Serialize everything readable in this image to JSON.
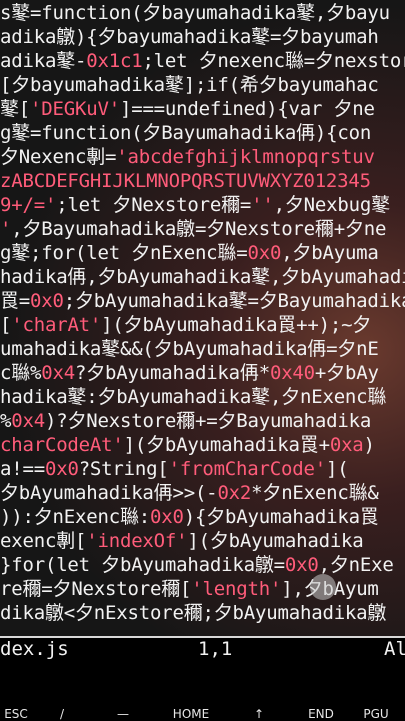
{
  "editor": {
    "lines": [
      [
        {
          "t": "pln",
          "v": "s鼕=function(夕bayumahadika鼕,夕bayu"
        }
      ],
      [
        {
          "t": "pln",
          "v": "adika鷻){夕bayumahadika鼕=夕bayumah"
        }
      ],
      [
        {
          "t": "pln",
          "v": "adika鼕-"
        },
        {
          "t": "num",
          "v": "0x1c1"
        },
        {
          "t": "pln",
          "v": ";let 夕nexenc䏈=夕nexstor"
        }
      ],
      [
        {
          "t": "pln",
          "v": "[夕bayumahadika鼕];if(希夕bayumahac"
        }
      ],
      [
        {
          "t": "pln",
          "v": "鼕["
        },
        {
          "t": "str",
          "v": "'DEGKuV'"
        },
        {
          "t": "pln",
          "v": "]===undefined){var 夕ne"
        }
      ],
      [
        {
          "t": "pln",
          "v": "g鼕=function(夕Bayumahadika侢){con"
        }
      ],
      [
        {
          "t": "pln",
          "v": "夕Nexenc剸="
        },
        {
          "t": "str",
          "v": "'abcdefghijklmnopqrstuv"
        }
      ],
      [
        {
          "t": "str",
          "v": "zABCDEFGHIJKLMNOPQRSTUVWXYZ012345"
        }
      ],
      [
        {
          "t": "str",
          "v": "9+/='"
        },
        {
          "t": "pln",
          "v": ";let 夕Nexstore穪="
        },
        {
          "t": "str",
          "v": "''"
        },
        {
          "t": "pln",
          "v": ",夕Nexbug鼕"
        }
      ],
      [
        {
          "t": "str",
          "v": "'"
        },
        {
          "t": "pln",
          "v": ",夕Bayumahadika鷻=夕Nexstore穪+夕ne"
        }
      ],
      [
        {
          "t": "pln",
          "v": "g鼕;for(let 夕nExenc䏈="
        },
        {
          "t": "num",
          "v": "0x0"
        },
        {
          "t": "pln",
          "v": ",夕bAyuma"
        }
      ],
      [
        {
          "t": "pln",
          "v": "hadika侢,夕bAyumahadika鼕,夕bAyumahadi"
        }
      ],
      [
        {
          "t": "pln",
          "v": "䍚="
        },
        {
          "t": "num",
          "v": "0x0"
        },
        {
          "t": "pln",
          "v": ";夕bAyumahadika鼕=夕Bayumahadika"
        }
      ],
      [
        {
          "t": "pln",
          "v": "["
        },
        {
          "t": "str",
          "v": "'charAt'"
        },
        {
          "t": "pln",
          "v": "](夕bAyumahadika䍚++);~夕"
        }
      ],
      [
        {
          "t": "pln",
          "v": "umahadika鼕&&(夕bAyumahadika侢=夕nE"
        }
      ],
      [
        {
          "t": "pln",
          "v": "c䏈%"
        },
        {
          "t": "num",
          "v": "0x4"
        },
        {
          "t": "pln",
          "v": "?夕bAyumahadika侢*"
        },
        {
          "t": "num",
          "v": "0x40"
        },
        {
          "t": "pln",
          "v": "+夕bAy"
        }
      ],
      [
        {
          "t": "pln",
          "v": "hadika鼕:夕bAyumahadika鼕,夕nExenc䏈"
        }
      ],
      [
        {
          "t": "pln",
          "v": "%"
        },
        {
          "t": "num",
          "v": "0x4"
        },
        {
          "t": "pln",
          "v": ")?夕Nexstore穪+=夕Bayumahadika"
        }
      ],
      [
        {
          "t": "str",
          "v": "charCodeAt'"
        },
        {
          "t": "pln",
          "v": "](夕bAyumahadika䍚+"
        },
        {
          "t": "num",
          "v": "0xa"
        },
        {
          "t": "pln",
          "v": ")"
        }
      ],
      [
        {
          "t": "pln",
          "v": "a!=="
        },
        {
          "t": "num",
          "v": "0x0"
        },
        {
          "t": "pln",
          "v": "?String["
        },
        {
          "t": "str",
          "v": "'fromCharCode'"
        },
        {
          "t": "pln",
          "v": "]("
        }
      ],
      [
        {
          "t": "pln",
          "v": "夕bAyumahadika侢>>(-"
        },
        {
          "t": "num",
          "v": "0x2"
        },
        {
          "t": "pln",
          "v": "*夕nExenc䏈&"
        }
      ],
      [
        {
          "t": "pln",
          "v": ")):夕nExenc䏈:"
        },
        {
          "t": "num",
          "v": "0x0"
        },
        {
          "t": "pln",
          "v": "){夕bAyumahadika䍚"
        }
      ],
      [
        {
          "t": "pln",
          "v": "exenc剸["
        },
        {
          "t": "str",
          "v": "'indexOf'"
        },
        {
          "t": "pln",
          "v": "](夕bAyumahadika"
        }
      ],
      [
        {
          "t": "pln",
          "v": "}for(let 夕bAyumahadika鷻="
        },
        {
          "t": "num",
          "v": "0x0"
        },
        {
          "t": "pln",
          "v": ",夕nExe"
        }
      ],
      [
        {
          "t": "pln",
          "v": "re穪=夕Nexstore穪["
        },
        {
          "t": "str",
          "v": "'length'"
        },
        {
          "t": "pln",
          "v": "],夕bAyum"
        }
      ],
      [
        {
          "t": "pln",
          "v": "dika鷻<夕nExstore穪;夕bAyumahadika鷻"
        }
      ]
    ]
  },
  "status": {
    "filename": "dex.js",
    "position": "1,1",
    "mode": "Al"
  },
  "keys": [
    "ESC",
    "/",
    "—",
    "HOME",
    "↑",
    "END",
    "PGU"
  ],
  "colors": {
    "text": "#f2f2f2",
    "string": "#ff5c7a",
    "background": "#111111"
  }
}
